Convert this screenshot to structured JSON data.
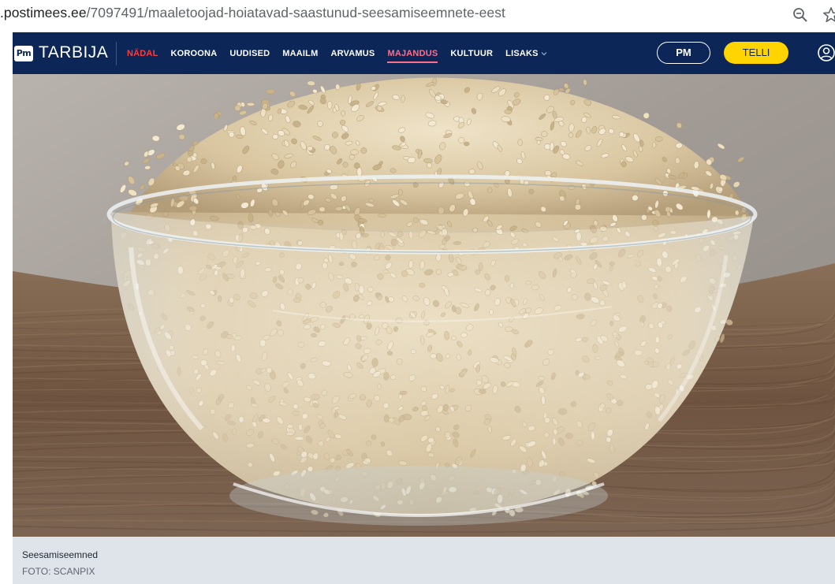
{
  "browser": {
    "url_host": ".postimees.ee",
    "url_path": "/7097491/maaletoojad-hoiatavad-saastunud-seesamiseemnete-eest",
    "zoom_icon": "magnifier-minus-icon",
    "bookmark_icon": "star-icon"
  },
  "site": {
    "logo_text": "Pm",
    "brand": "TARBIJA",
    "nav": [
      {
        "label": "NÄDAL",
        "style": "red"
      },
      {
        "label": "KOROONA",
        "style": "normal"
      },
      {
        "label": "UUDISED",
        "style": "normal"
      },
      {
        "label": "MAAILM",
        "style": "normal"
      },
      {
        "label": "ARVAMUS",
        "style": "normal"
      },
      {
        "label": "MAJANDUS",
        "style": "active"
      },
      {
        "label": "KULTUUR",
        "style": "normal"
      },
      {
        "label": "LISAKS",
        "style": "dropdown"
      }
    ],
    "pm_button": "PM",
    "subscribe_button": "TELLI",
    "user_icon": "user-circle-icon",
    "colors": {
      "nav_bg": "#0c2657",
      "subscribe_bg": "#ffd400",
      "active": "#ff6f8a",
      "highlight": "#ff3b3b"
    }
  },
  "article": {
    "image_subject": "glass bowl of sesame seeds",
    "caption": "Seesamiseemned",
    "credit": "FOTO: SCANPIX"
  }
}
